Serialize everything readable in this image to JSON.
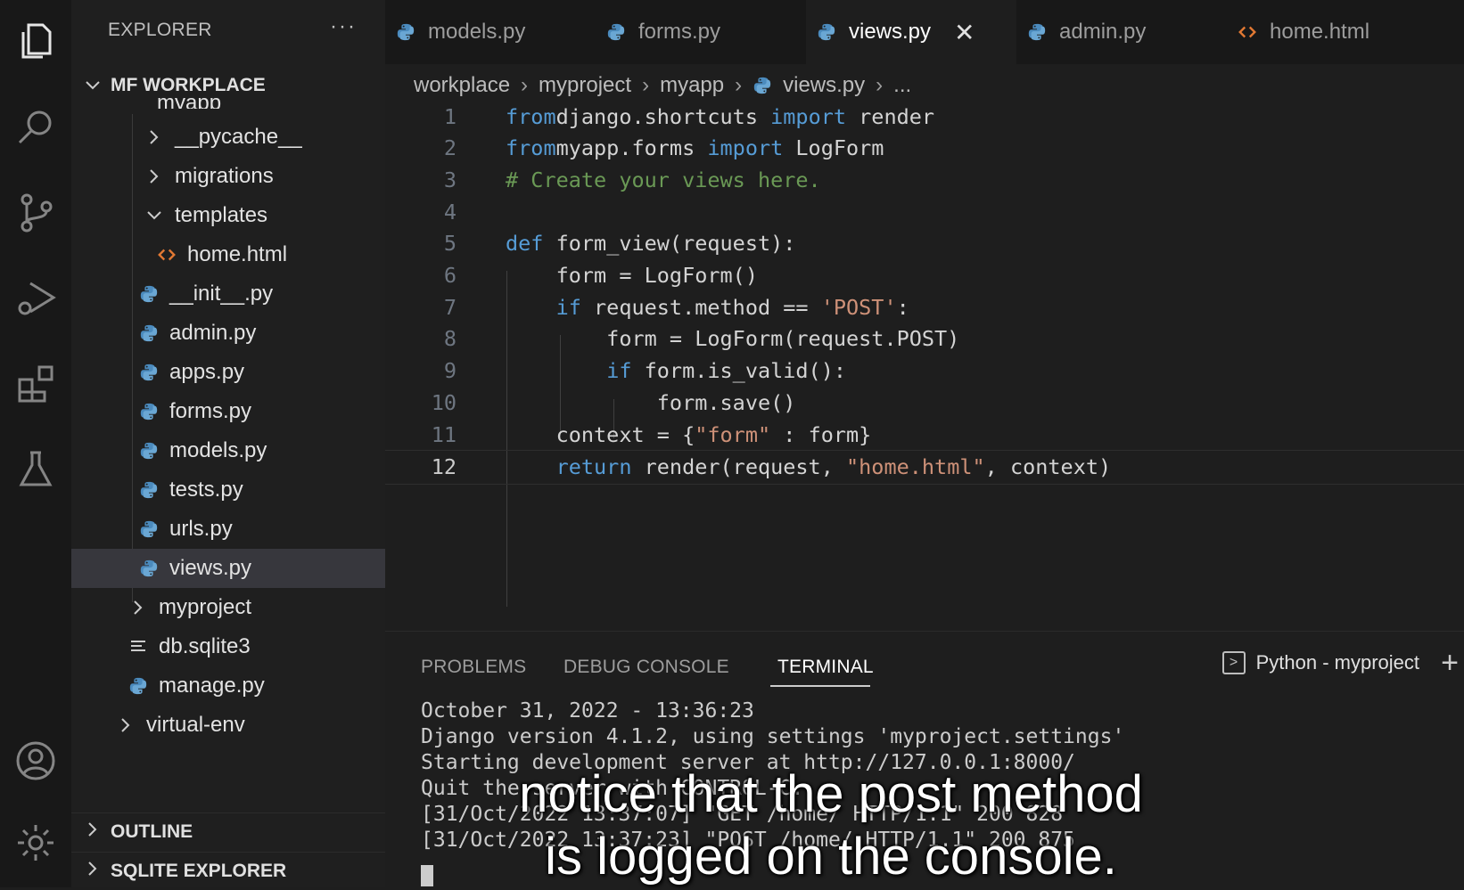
{
  "colors": {
    "activity_bg": "#181818",
    "sidebar_bg": "#1f1f1f",
    "editor_bg": "#1e1e1e",
    "keyword": "#569cd6",
    "string": "#ce9178",
    "comment": "#6a9955",
    "python_icon": "#4b8bbe",
    "html_icon": "#e37933"
  },
  "activity_bar": {
    "icons": [
      "explorer-icon",
      "search-icon",
      "source-control-icon",
      "run-debug-icon",
      "extensions-icon",
      "testing-icon",
      "account-icon",
      "settings-icon"
    ]
  },
  "sidebar": {
    "title": "EXPLORER",
    "more_actions": "···",
    "workspace": "MF WORKPLACE",
    "partial_folder": "myapp",
    "tree": [
      {
        "label": "__pycache__",
        "icon": "chevron-right-icon"
      },
      {
        "label": "migrations",
        "icon": "chevron-right-icon"
      },
      {
        "label": "templates",
        "icon": "chevron-down-icon"
      },
      {
        "label": "home.html",
        "icon": "html-file-icon"
      },
      {
        "label": "__init__.py",
        "icon": "python-file-icon"
      },
      {
        "label": "admin.py",
        "icon": "python-file-icon"
      },
      {
        "label": "apps.py",
        "icon": "python-file-icon"
      },
      {
        "label": "forms.py",
        "icon": "python-file-icon"
      },
      {
        "label": "models.py",
        "icon": "python-file-icon"
      },
      {
        "label": "tests.py",
        "icon": "python-file-icon"
      },
      {
        "label": "urls.py",
        "icon": "python-file-icon"
      },
      {
        "label": "views.py",
        "icon": "python-file-icon"
      },
      {
        "label": "myproject",
        "icon": "chevron-right-icon"
      },
      {
        "label": "db.sqlite3",
        "icon": "database-file-icon"
      },
      {
        "label": "manage.py",
        "icon": "python-file-icon"
      },
      {
        "label": "virtual-env",
        "icon": "chevron-right-icon"
      }
    ],
    "sections": [
      {
        "label": "OUTLINE"
      },
      {
        "label": "SQLITE EXPLORER"
      }
    ]
  },
  "tabs": [
    {
      "label": "models.py",
      "icon": "python-file-icon"
    },
    {
      "label": "forms.py",
      "icon": "python-file-icon"
    },
    {
      "label": "views.py",
      "icon": "python-file-icon",
      "active": true,
      "close": "✕"
    },
    {
      "label": "admin.py",
      "icon": "python-file-icon"
    },
    {
      "label": "home.html",
      "icon": "html-file-icon"
    }
  ],
  "breadcrumb": {
    "items": [
      "workplace",
      "myproject",
      "myapp",
      "views.py",
      "..."
    ],
    "separator": "›"
  },
  "editor": {
    "current_line": 12,
    "lines": [
      {
        "n": "1",
        "tokens": [
          [
            "kw",
            "from"
          ],
          [
            "",
            "django.shortcuts "
          ],
          [
            "kw",
            "import"
          ],
          [
            "",
            " render"
          ]
        ]
      },
      {
        "n": "2",
        "tokens": [
          [
            "kw",
            "from"
          ],
          [
            "",
            "myapp.forms "
          ],
          [
            "kw",
            "import"
          ],
          [
            "",
            " LogForm"
          ]
        ]
      },
      {
        "n": "3",
        "tokens": [
          [
            "cm",
            "# Create your views here."
          ]
        ]
      },
      {
        "n": "4",
        "tokens": []
      },
      {
        "n": "5",
        "tokens": [
          [
            "kw",
            "def"
          ],
          [
            "",
            " form_view(request):"
          ]
        ]
      },
      {
        "n": "6",
        "tokens": [
          [
            "",
            "    form = LogForm()"
          ]
        ]
      },
      {
        "n": "7",
        "tokens": [
          [
            "",
            "    "
          ],
          [
            "kw",
            "if"
          ],
          [
            "",
            " request.method == "
          ],
          [
            "str",
            "'POST'"
          ],
          [
            "",
            ":"
          ]
        ]
      },
      {
        "n": "8",
        "tokens": [
          [
            "",
            "        form = LogForm(request.POST)"
          ]
        ]
      },
      {
        "n": "9",
        "tokens": [
          [
            "",
            "        "
          ],
          [
            "kw",
            "if"
          ],
          [
            "",
            " form.is_valid():"
          ]
        ]
      },
      {
        "n": "10",
        "tokens": [
          [
            "",
            "            form.save()"
          ]
        ]
      },
      {
        "n": "11",
        "tokens": [
          [
            "",
            "    context = {"
          ],
          [
            "str",
            "\"form\""
          ],
          [
            "",
            " : form}"
          ]
        ]
      },
      {
        "n": "12",
        "tokens": [
          [
            "",
            "    "
          ],
          [
            "kw",
            "return"
          ],
          [
            "",
            " render(request, "
          ],
          [
            "str",
            "\"home.html\""
          ],
          [
            "",
            ", context)"
          ]
        ]
      }
    ]
  },
  "panel": {
    "tabs": [
      {
        "label": "PROBLEMS"
      },
      {
        "label": "DEBUG CONSOLE"
      },
      {
        "label": "TERMINAL",
        "active": true
      }
    ],
    "terminal_name": "Python - myproject",
    "terminal_glyph": ">",
    "new_terminal": "+",
    "lines": [
      "October 31, 2022 - 13:36:23",
      "Django version 4.1.2, using settings 'myproject.settings'",
      "Starting development server at http://127.0.0.1:8000/",
      "Quit the server with CONTROL-C.",
      "[31/Oct/2022 13:37:07] \"GET /home/ HTTP/1.1\" 200 828",
      "[31/Oct/2022 13:37:23] \"POST /home/ HTTP/1.1\" 200 875"
    ]
  },
  "caption": {
    "line1": "notice that the post method",
    "line2": "is logged on the console."
  }
}
